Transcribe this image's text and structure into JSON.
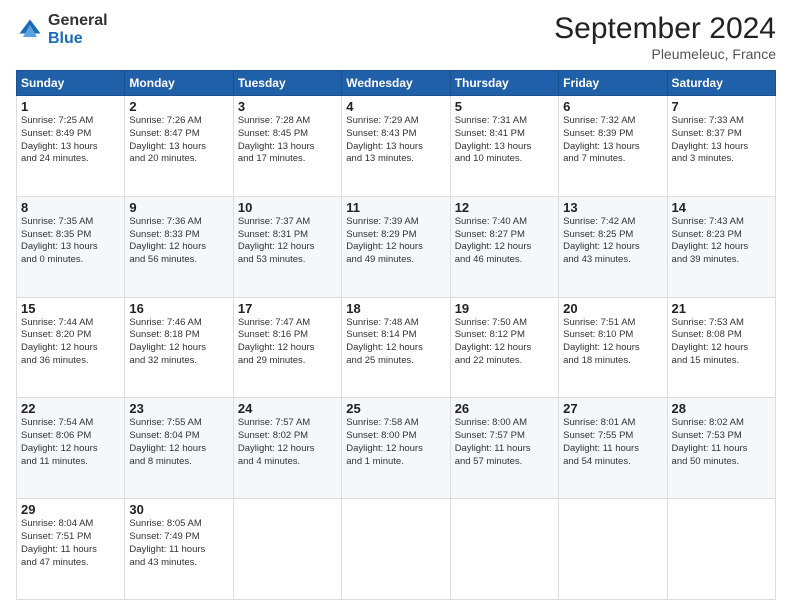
{
  "logo": {
    "general": "General",
    "blue": "Blue"
  },
  "header": {
    "title": "September 2024",
    "subtitle": "Pleumeleuc, France"
  },
  "calendar": {
    "days": [
      "Sunday",
      "Monday",
      "Tuesday",
      "Wednesday",
      "Thursday",
      "Friday",
      "Saturday"
    ],
    "weeks": [
      [
        null,
        {
          "day": "2",
          "sunrise": "7:26 AM",
          "sunset": "8:47 PM",
          "daylight": "13 hours and 20 minutes."
        },
        {
          "day": "3",
          "sunrise": "7:28 AM",
          "sunset": "8:45 PM",
          "daylight": "13 hours and 17 minutes."
        },
        {
          "day": "4",
          "sunrise": "7:29 AM",
          "sunset": "8:43 PM",
          "daylight": "13 hours and 13 minutes."
        },
        {
          "day": "5",
          "sunrise": "7:31 AM",
          "sunset": "8:41 PM",
          "daylight": "13 hours and 10 minutes."
        },
        {
          "day": "6",
          "sunrise": "7:32 AM",
          "sunset": "8:39 PM",
          "daylight": "13 hours and 7 minutes."
        },
        {
          "day": "7",
          "sunrise": "7:33 AM",
          "sunset": "8:37 PM",
          "daylight": "13 hours and 3 minutes."
        }
      ],
      [
        {
          "day": "1",
          "sunrise": "7:25 AM",
          "sunset": "8:49 PM",
          "daylight": "13 hours and 24 minutes."
        },
        {
          "day": "9",
          "sunrise": "7:36 AM",
          "sunset": "8:33 PM",
          "daylight": "12 hours and 56 minutes."
        },
        {
          "day": "10",
          "sunrise": "7:37 AM",
          "sunset": "8:31 PM",
          "daylight": "12 hours and 53 minutes."
        },
        {
          "day": "11",
          "sunrise": "7:39 AM",
          "sunset": "8:29 PM",
          "daylight": "12 hours and 49 minutes."
        },
        {
          "day": "12",
          "sunrise": "7:40 AM",
          "sunset": "8:27 PM",
          "daylight": "12 hours and 46 minutes."
        },
        {
          "day": "13",
          "sunrise": "7:42 AM",
          "sunset": "8:25 PM",
          "daylight": "12 hours and 43 minutes."
        },
        {
          "day": "14",
          "sunrise": "7:43 AM",
          "sunset": "8:23 PM",
          "daylight": "12 hours and 39 minutes."
        }
      ],
      [
        {
          "day": "8",
          "sunrise": "7:35 AM",
          "sunset": "8:35 PM",
          "daylight": "13 hours and 0 minutes."
        },
        {
          "day": "16",
          "sunrise": "7:46 AM",
          "sunset": "8:18 PM",
          "daylight": "12 hours and 32 minutes."
        },
        {
          "day": "17",
          "sunrise": "7:47 AM",
          "sunset": "8:16 PM",
          "daylight": "12 hours and 29 minutes."
        },
        {
          "day": "18",
          "sunrise": "7:48 AM",
          "sunset": "8:14 PM",
          "daylight": "12 hours and 25 minutes."
        },
        {
          "day": "19",
          "sunrise": "7:50 AM",
          "sunset": "8:12 PM",
          "daylight": "12 hours and 22 minutes."
        },
        {
          "day": "20",
          "sunrise": "7:51 AM",
          "sunset": "8:10 PM",
          "daylight": "12 hours and 18 minutes."
        },
        {
          "day": "21",
          "sunrise": "7:53 AM",
          "sunset": "8:08 PM",
          "daylight": "12 hours and 15 minutes."
        }
      ],
      [
        {
          "day": "15",
          "sunrise": "7:44 AM",
          "sunset": "8:20 PM",
          "daylight": "12 hours and 36 minutes."
        },
        {
          "day": "23",
          "sunrise": "7:55 AM",
          "sunset": "8:04 PM",
          "daylight": "12 hours and 8 minutes."
        },
        {
          "day": "24",
          "sunrise": "7:57 AM",
          "sunset": "8:02 PM",
          "daylight": "12 hours and 4 minutes."
        },
        {
          "day": "25",
          "sunrise": "7:58 AM",
          "sunset": "8:00 PM",
          "daylight": "12 hours and 1 minute."
        },
        {
          "day": "26",
          "sunrise": "8:00 AM",
          "sunset": "7:57 PM",
          "daylight": "11 hours and 57 minutes."
        },
        {
          "day": "27",
          "sunrise": "8:01 AM",
          "sunset": "7:55 PM",
          "daylight": "11 hours and 54 minutes."
        },
        {
          "day": "28",
          "sunrise": "8:02 AM",
          "sunset": "7:53 PM",
          "daylight": "11 hours and 50 minutes."
        }
      ],
      [
        {
          "day": "22",
          "sunrise": "7:54 AM",
          "sunset": "8:06 PM",
          "daylight": "12 hours and 11 minutes."
        },
        {
          "day": "30",
          "sunrise": "8:05 AM",
          "sunset": "7:49 PM",
          "daylight": "11 hours and 43 minutes."
        },
        null,
        null,
        null,
        null,
        null
      ],
      [
        {
          "day": "29",
          "sunrise": "8:04 AM",
          "sunset": "7:51 PM",
          "daylight": "11 hours and 47 minutes."
        },
        null,
        null,
        null,
        null,
        null,
        null
      ]
    ]
  }
}
